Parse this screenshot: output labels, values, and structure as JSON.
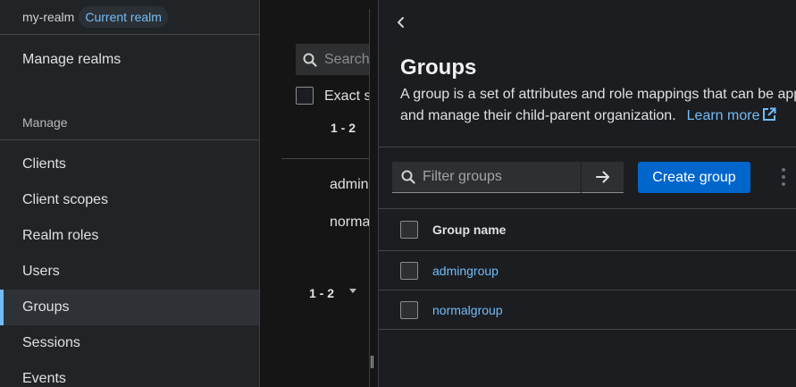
{
  "sidebar": {
    "realm_name": "my-realm",
    "realm_badge": "Current realm",
    "manage_realms": "Manage realms",
    "section_title": "Manage",
    "items": [
      {
        "label": "Clients"
      },
      {
        "label": "Client scopes"
      },
      {
        "label": "Realm roles"
      },
      {
        "label": "Users"
      },
      {
        "label": "Groups",
        "active": true
      },
      {
        "label": "Sessions"
      },
      {
        "label": "Events"
      }
    ]
  },
  "background": {
    "search_placeholder": "Search",
    "exact_label": "Exact s",
    "pagination_top": "1 - 2",
    "rows": [
      "admin",
      "norma"
    ],
    "pagination_bottom": "1 - 2"
  },
  "drawer": {
    "title": "Groups",
    "description_line1": "A group is a set of attributes and role mappings that can be app",
    "description_line2": "and manage their child-parent organization.",
    "learn_more": "Learn more",
    "filter_placeholder": "Filter groups",
    "create_button": "Create group",
    "table": {
      "column_header": "Group name",
      "rows": [
        {
          "name": "admingroup"
        },
        {
          "name": "normalgroup"
        }
      ]
    }
  },
  "colors": {
    "accent": "#0066cc",
    "link": "#73bcf7",
    "active_bar": "#73bcf7"
  }
}
